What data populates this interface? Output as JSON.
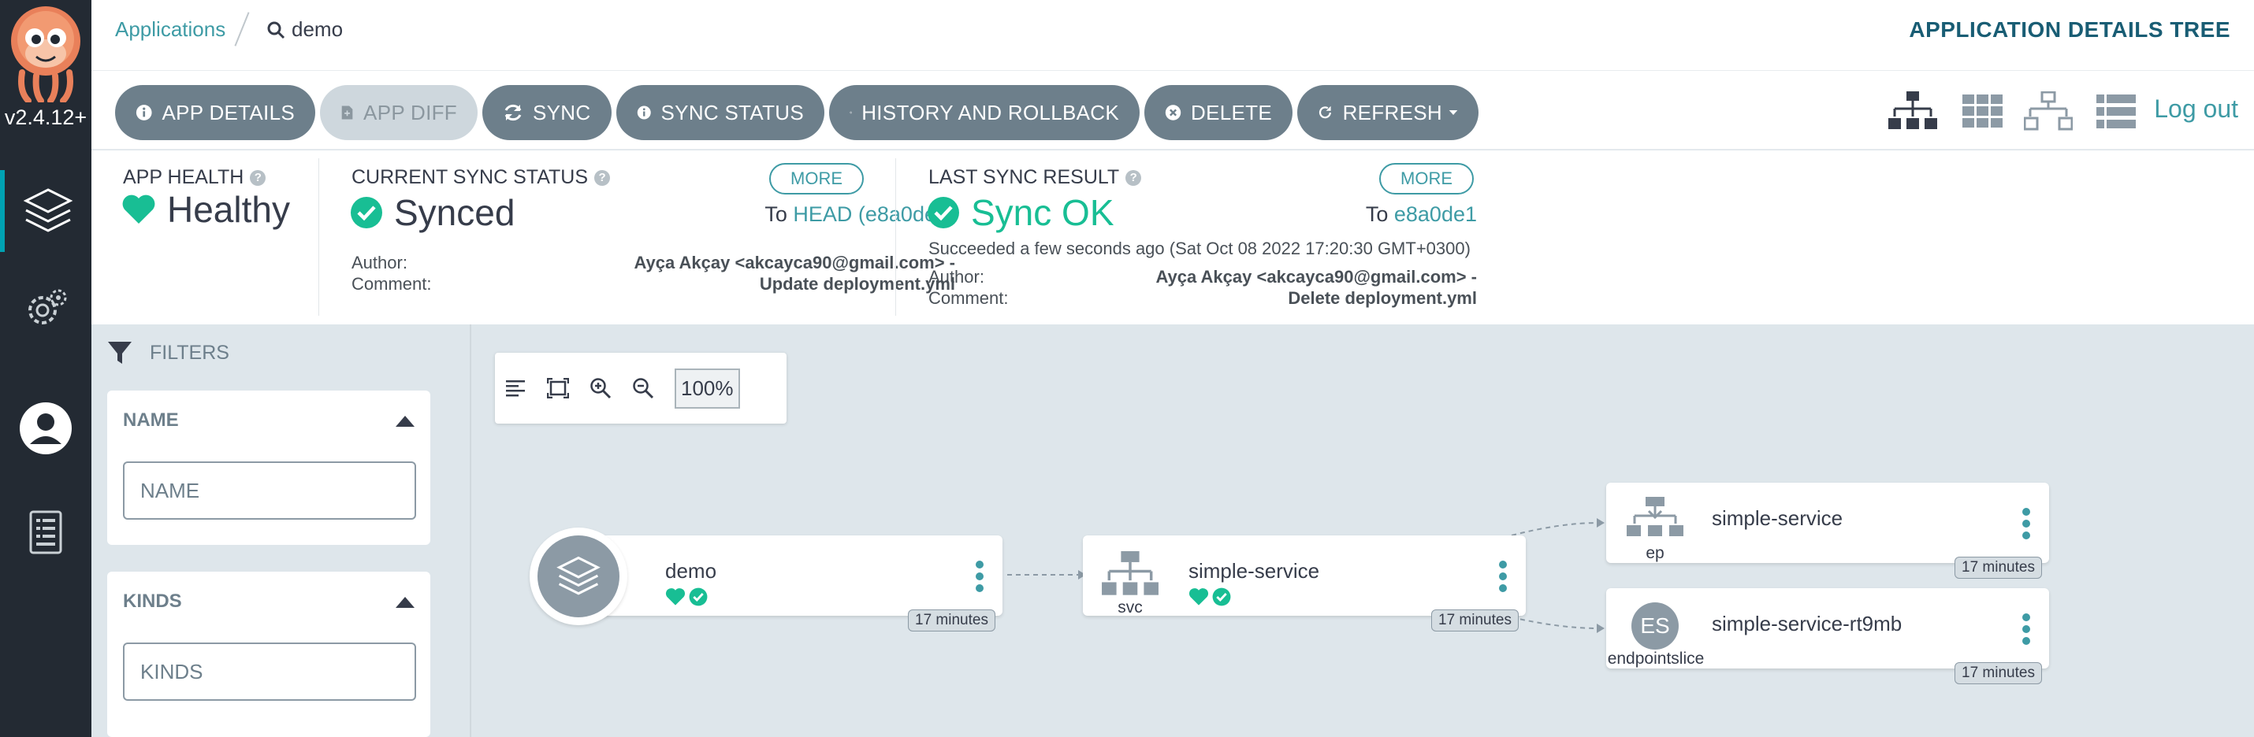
{
  "app": {
    "version": "v2.4.12+"
  },
  "breadcrumb": {
    "applications": "Applications",
    "current": "demo"
  },
  "page_title": "APPLICATION DETAILS TREE",
  "toolbar": {
    "buttons": [
      {
        "label": "APP DETAILS",
        "icon": "info-icon",
        "enabled": true
      },
      {
        "label": "APP DIFF",
        "icon": "file-diff-icon",
        "enabled": false
      },
      {
        "label": "SYNC",
        "icon": "sync-icon",
        "enabled": true
      },
      {
        "label": "SYNC STATUS",
        "icon": "info-icon",
        "enabled": true
      },
      {
        "label": "HISTORY AND ROLLBACK",
        "icon": "history-icon",
        "enabled": true
      },
      {
        "label": "DELETE",
        "icon": "close-circle-icon",
        "enabled": true
      },
      {
        "label": "REFRESH",
        "icon": "refresh-icon",
        "enabled": true
      }
    ],
    "views": [
      "tree-view-icon",
      "pods-view-icon",
      "network-view-icon",
      "list-view-icon"
    ],
    "logout": "Log out"
  },
  "status": {
    "health": {
      "label": "APP HEALTH",
      "value": "Healthy"
    },
    "current_sync": {
      "label": "CURRENT SYNC STATUS",
      "value": "Synced",
      "more": "MORE",
      "to_prefix": "To",
      "to_link": "HEAD (e8a0de1)",
      "author_label": "Author:",
      "author": "Ayça Akçay <akcayca90@gmail.com> -",
      "comment_label": "Comment:",
      "comment": "Update deployment.yml"
    },
    "last_sync": {
      "label": "LAST SYNC RESULT",
      "value": "Sync OK",
      "more": "MORE",
      "to_prefix": "To",
      "to_link": "e8a0de1",
      "succeeded": "Succeeded a few seconds ago (Sat Oct 08 2022 17:20:30 GMT+0300)",
      "author_label": "Author:",
      "author": "Ayça Akçay <akcayca90@gmail.com> -",
      "comment_label": "Comment:",
      "comment": "Delete deployment.yml"
    }
  },
  "filters": {
    "title": "FILTERS",
    "name": {
      "head": "NAME",
      "placeholder": "NAME"
    },
    "kinds": {
      "head": "KINDS",
      "placeholder": "KINDS"
    }
  },
  "graph": {
    "zoom": "100%",
    "nodes": {
      "demo": {
        "name": "demo",
        "age": "17 minutes"
      },
      "svc": {
        "name": "simple-service",
        "kind": "svc",
        "age": "17 minutes"
      },
      "ep": {
        "name": "simple-service",
        "kind": "ep",
        "age": "17 minutes"
      },
      "eps": {
        "name": "simple-service-rt9mb",
        "kind": "endpointslice",
        "badge": "ES",
        "age": "17 minutes"
      }
    }
  },
  "colors": {
    "accent": "#3e9ba5",
    "healthy": "#18be94",
    "rail": "#232a33",
    "button": "#6d7f8b"
  }
}
